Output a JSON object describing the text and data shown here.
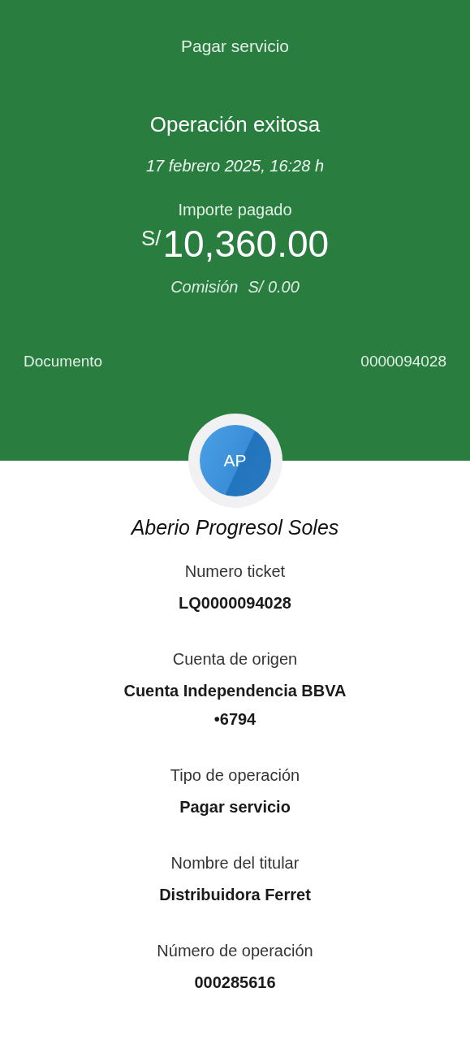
{
  "header": {
    "title": "Pagar servicio"
  },
  "status": "Operación exitosa",
  "datetime": "17 febrero 2025,  16:28 h",
  "amount": {
    "label": "Importe pagado",
    "currency": "S/",
    "value": "10,360.00"
  },
  "commission": {
    "label": "Comisión",
    "value": "S/ 0.00"
  },
  "document": {
    "label": "Documento",
    "value": "0000094028"
  },
  "avatar": {
    "initials": "AP"
  },
  "payee": "Aberio Progresol Soles",
  "details": [
    {
      "label": "Numero ticket",
      "value": "LQ0000094028"
    },
    {
      "label": "Cuenta de origen",
      "value": "Cuenta Independencia BBVA •6794"
    },
    {
      "label": "Tipo de operación",
      "value": "Pagar servicio"
    },
    {
      "label": "Nombre del titular",
      "value": "Distribuidora Ferret"
    },
    {
      "label": "Número de operación",
      "value": "000285616"
    }
  ]
}
